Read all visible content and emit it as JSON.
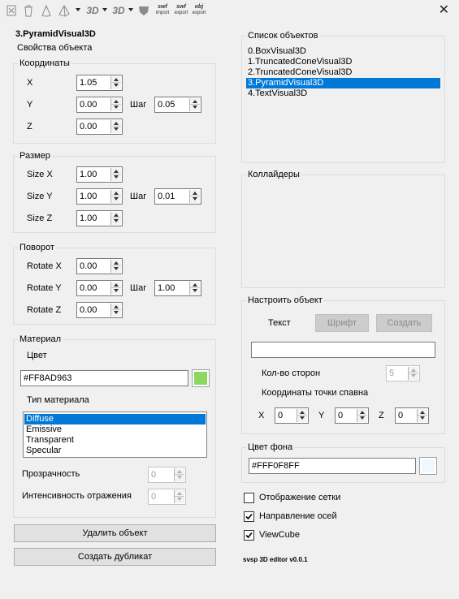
{
  "toolbar": {
    "items": [
      "3D",
      "3D"
    ],
    "swf_import": {
      "top": "swf",
      "bottom": "import"
    },
    "swf_export": {
      "top": "swf",
      "bottom": "export"
    },
    "obj_export": {
      "top": "obj",
      "bottom": "export"
    },
    "close": "✕"
  },
  "object_title": "3.PyramidVisual3D",
  "properties_label": "Свойства объекта",
  "coords": {
    "legend": "Координаты",
    "x_label": "X",
    "x_value": "1.05",
    "y_label": "Y",
    "y_value": "0.00",
    "z_label": "Z",
    "z_value": "0.00",
    "step_label": "Шаг",
    "step_value": "0.05"
  },
  "size": {
    "legend": "Размер",
    "x_label": "Size X",
    "x_value": "1.00",
    "y_label": "Size Y",
    "y_value": "1.00",
    "z_label": "Size Z",
    "z_value": "1.00",
    "step_label": "Шаг",
    "step_value": "0.01"
  },
  "rotation": {
    "legend": "Поворот",
    "x_label": "Rotate X",
    "x_value": "0.00",
    "y_label": "Rotate Y",
    "y_value": "0.00",
    "z_label": "Rotate Z",
    "z_value": "0.00",
    "step_label": "Шаг",
    "step_value": "1.00"
  },
  "material": {
    "legend": "Материал",
    "color_label": "Цвет",
    "color_value": "#FF8AD963",
    "swatch_color": "#8ad963",
    "type_label": "Тип материала",
    "types": [
      "Diffuse",
      "Emissive",
      "Transparent",
      "Specular"
    ],
    "selected_type": "Diffuse",
    "opacity_label": "Прозрачность",
    "opacity_value": "0",
    "reflect_label": "Интенсивность отражения",
    "reflect_value": "0"
  },
  "buttons": {
    "delete": "Удалить объект",
    "duplicate": "Создать дубликат"
  },
  "objects": {
    "legend": "Список объектов",
    "items": [
      "0.BoxVisual3D",
      "1.TruncatedConeVisual3D",
      "2.TruncatedConeVisual3D",
      "3.PyramidVisual3D",
      "4.TextVisual3D"
    ],
    "selected": "3.PyramidVisual3D"
  },
  "colliders": {
    "legend": "Коллайдеры"
  },
  "configure": {
    "legend": "Настроить объект",
    "text_label": "Текст",
    "font_button": "Шрифт",
    "create_button": "Создать",
    "text_value": "",
    "sides_label": "Кол-во сторон",
    "sides_value": "5",
    "spawn_label": "Координаты точки спавна",
    "x_label": "X",
    "x_value": "0",
    "y_label": "Y",
    "y_value": "0",
    "z_label": "Z",
    "z_value": "0"
  },
  "background": {
    "legend": "Цвет фона",
    "value": "#FFF0F8FF",
    "swatch_color": "#f0f8ff"
  },
  "checks": {
    "grid": {
      "label": "Отображение сетки",
      "checked": false
    },
    "axes": {
      "label": "Направление осей",
      "checked": true
    },
    "viewcube": {
      "label": "ViewCube",
      "checked": true
    }
  },
  "version": "svsp 3D editor v0.0.1",
  "colors": {
    "selection": "#0078d7",
    "panel": "#f0f0f0"
  }
}
